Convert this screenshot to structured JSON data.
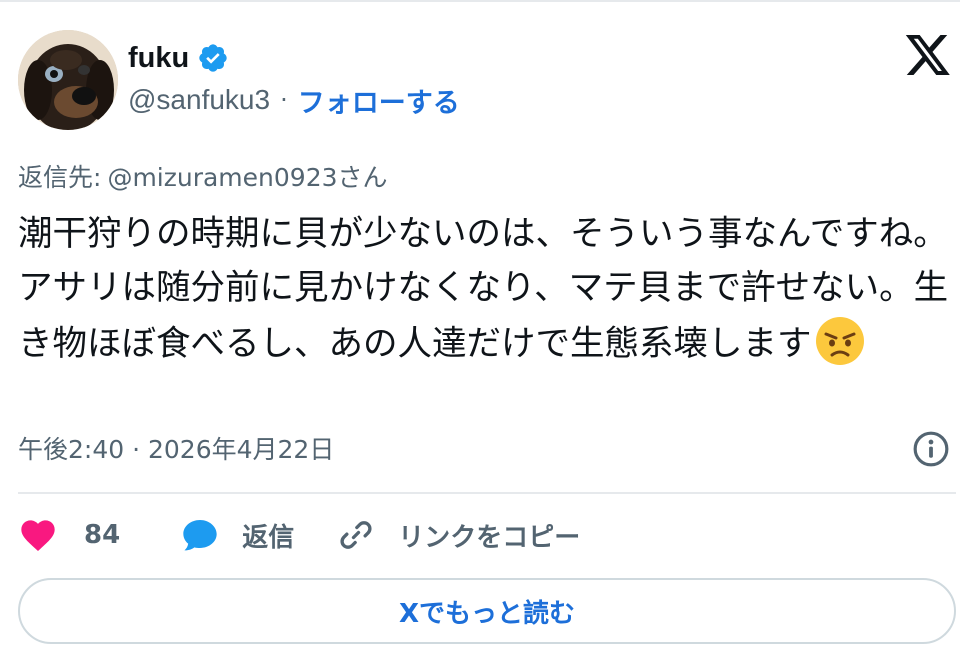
{
  "author": {
    "display_name": "fuku",
    "handle": "@sanfuku3",
    "separator": "·",
    "follow_label": "フォローする",
    "avatar_icon": "dachshund-avatar-photo",
    "verified_color": "#1d9bf0"
  },
  "reply": {
    "prefix": "返信先:",
    "target": "@mizuramen0923さん"
  },
  "tweet": {
    "text": "潮干狩りの時期に貝が少ないのは、そういう事なんですね。アサリは随分前に見かけなくなり、マテ貝まで許せない。生き物ほぼ食べるし、あの人達だけで生態系壊します",
    "emoji": "angry-face-emoji"
  },
  "timestamp": "午後2:40 · 2026年4月22日",
  "actions": {
    "like_count": "84",
    "reply_label": "返信",
    "copy_link_label": "リンクをコピー"
  },
  "read_more_label": "Xでもっと読む",
  "colors": {
    "accent": "#1d6fd9",
    "like": "#f91880",
    "reply_icon": "#1d9bf0",
    "muted": "#536471"
  }
}
